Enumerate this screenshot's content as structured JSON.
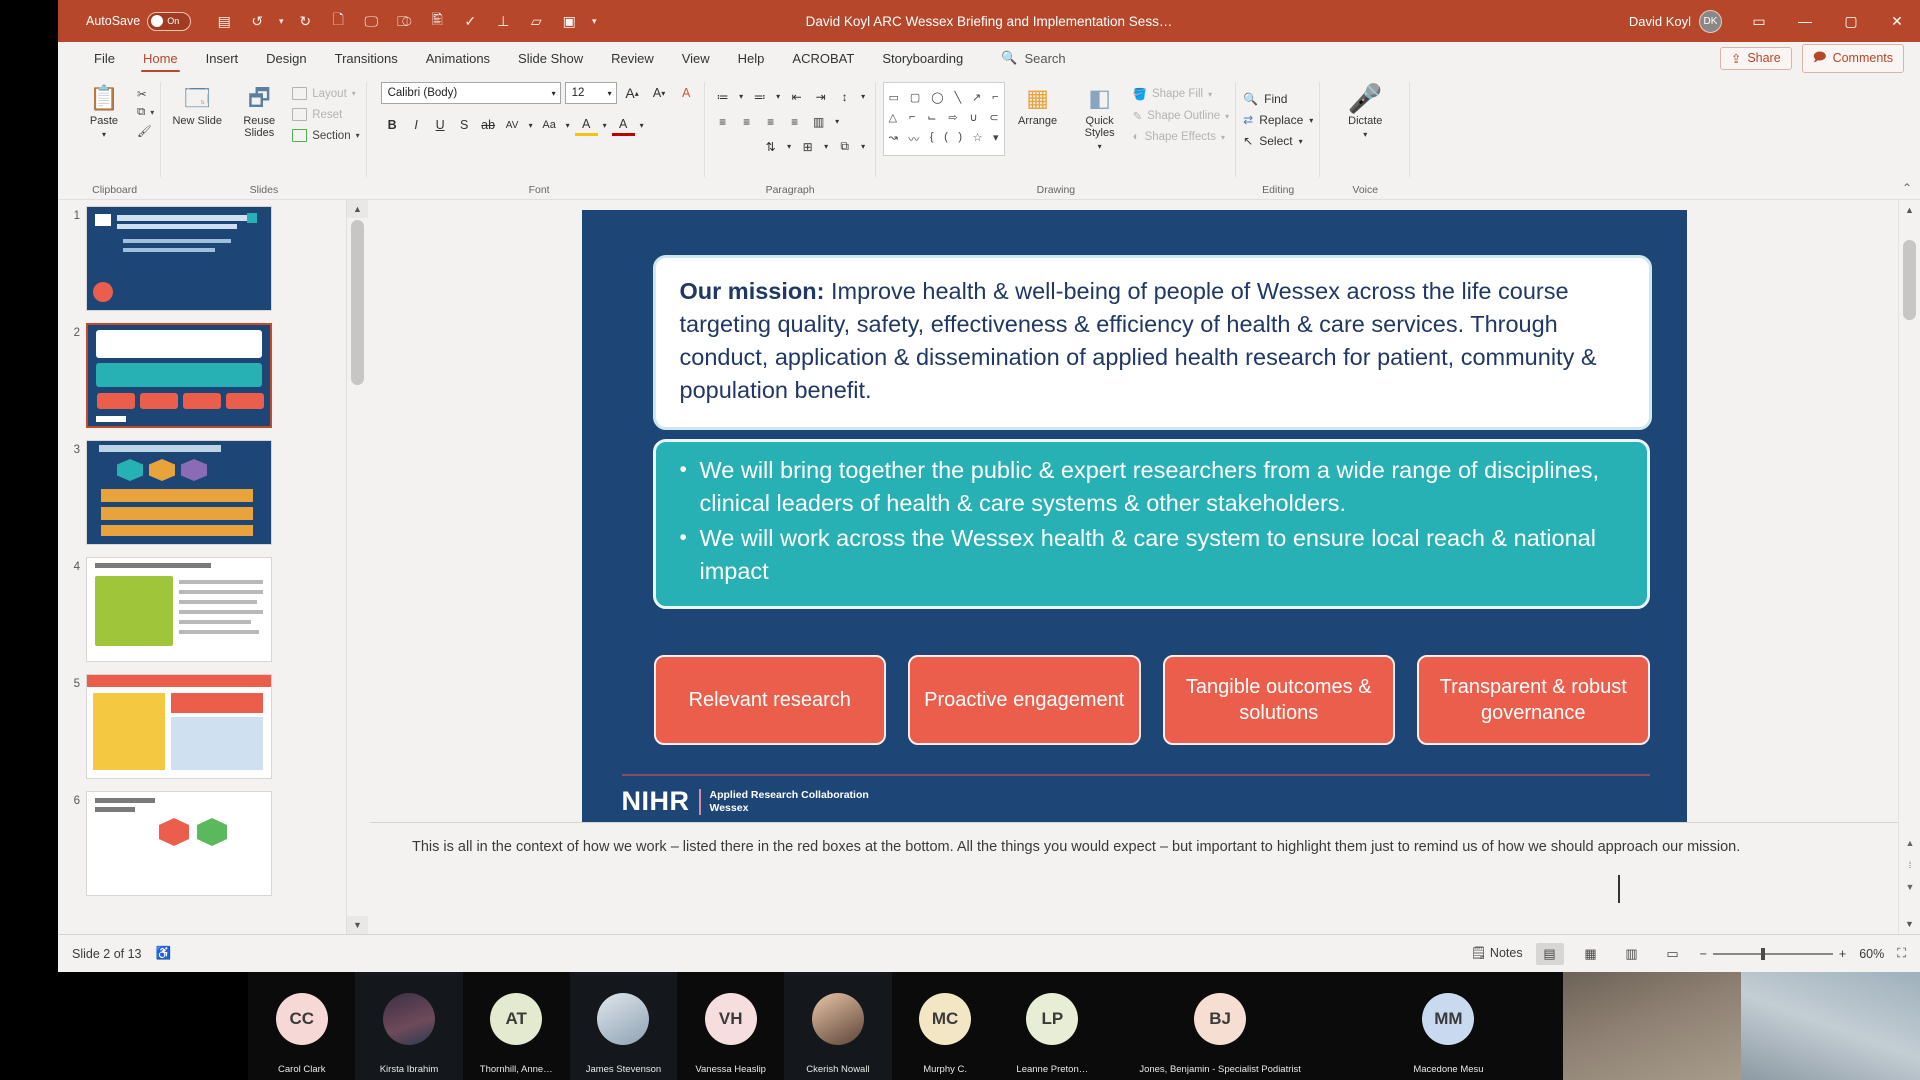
{
  "window": {
    "title": "David Koyl ARC Wessex Briefing and Implementation Sess…",
    "autosave_label": "AutoSave",
    "autosave_state": "On",
    "user_name": "David Koyl",
    "user_initials": "DK",
    "minimize": "—",
    "maximize": "▢",
    "close": "✕",
    "ribbon_display": "▭"
  },
  "quick_access": [
    {
      "name": "save-icon",
      "glyph": "▤"
    },
    {
      "name": "undo-icon",
      "glyph": "↺"
    },
    {
      "name": "undo-dropdown-icon",
      "glyph": "▾"
    },
    {
      "name": "redo-icon",
      "glyph": "↻"
    },
    {
      "name": "new-slide-icon",
      "glyph": "🗋"
    },
    {
      "name": "start-presentation-icon",
      "glyph": "🖵"
    },
    {
      "name": "present-online-icon",
      "glyph": "⎄"
    },
    {
      "name": "print-preview-icon",
      "glyph": "🖺"
    },
    {
      "name": "spelling-icon",
      "glyph": "✓"
    },
    {
      "name": "presenter-view-icon",
      "glyph": "⊥"
    },
    {
      "name": "from-beginning-icon",
      "glyph": "▱"
    },
    {
      "name": "record-icon",
      "glyph": "▣"
    },
    {
      "name": "customize-qat-icon",
      "glyph": "▾"
    }
  ],
  "tabs": [
    {
      "label": "File",
      "active": false
    },
    {
      "label": "Home",
      "active": true
    },
    {
      "label": "Insert",
      "active": false
    },
    {
      "label": "Design",
      "active": false
    },
    {
      "label": "Transitions",
      "active": false
    },
    {
      "label": "Animations",
      "active": false
    },
    {
      "label": "Slide Show",
      "active": false
    },
    {
      "label": "Review",
      "active": false
    },
    {
      "label": "View",
      "active": false
    },
    {
      "label": "Help",
      "active": false
    },
    {
      "label": "ACROBAT",
      "active": false
    },
    {
      "label": "Storyboarding",
      "active": false
    }
  ],
  "search": {
    "label": "Search",
    "icon": "search-icon"
  },
  "tab_actions": {
    "share": "Share",
    "comments": "Comments"
  },
  "ribbon": {
    "clipboard": {
      "label": "Clipboard",
      "paste": "Paste",
      "cut": "Cut",
      "copy": "Copy",
      "format_painter": "Format Painter"
    },
    "slides": {
      "label": "Slides",
      "new_slide": "New Slide",
      "reuse_slides": "Reuse Slides",
      "layout": "Layout",
      "reset": "Reset",
      "section": "Section"
    },
    "font": {
      "label": "Font",
      "family": "Calibri (Body)",
      "size": "12",
      "grow": "A",
      "shrink": "A",
      "clear_formatting": "A",
      "bold": "B",
      "italic": "I",
      "underline": "U",
      "shadow": "S",
      "strikethrough": "ab",
      "character_spacing": "AV",
      "change_case": "Aa",
      "text_highlight": "A",
      "font_color": "A"
    },
    "paragraph": {
      "label": "Paragraph",
      "bullets": "≔",
      "numbering": "≕",
      "decrease_indent": "⇤",
      "increase_indent": "⇥",
      "line_spacing": "↕",
      "align_left": "≡",
      "align_center": "≡",
      "align_right": "≡",
      "justify": "≡",
      "columns": "▥",
      "text_direction": "⇅",
      "align_text": "⊞",
      "convert_smartart": "⧉"
    },
    "drawing": {
      "label": "Drawing",
      "arrange": "Arrange",
      "quick_styles": "Quick Styles",
      "shape_fill": "Shape Fill",
      "shape_outline": "Shape Outline",
      "shape_effects": "Shape Effects"
    },
    "editing": {
      "label": "Editing",
      "find": "Find",
      "replace": "Replace",
      "select": "Select"
    },
    "voice": {
      "label": "Voice",
      "dictate": "Dictate"
    }
  },
  "thumbnails": [
    {
      "number": "1",
      "selected": false
    },
    {
      "number": "2",
      "selected": true
    },
    {
      "number": "3",
      "selected": false
    },
    {
      "number": "4",
      "selected": false
    },
    {
      "number": "5",
      "selected": false
    },
    {
      "number": "6",
      "selected": false
    }
  ],
  "slide": {
    "mission_label": "Our mission:",
    "mission_text": " Improve health & well-being of people of Wessex across the life course targeting quality, safety, effectiveness & efficiency of health & care services. Through conduct, application & dissemination of applied health research for patient, community & population benefit.",
    "aims": [
      "We will bring together the public & expert researchers from a wide range of disciplines, clinical leaders of health & care systems & other stakeholders.",
      "We will work across the Wessex health & care system to ensure local reach & national impact"
    ],
    "pills": [
      "Relevant research",
      "Proactive engagement",
      "Tangible outcomes & solutions",
      "Transparent & robust governance"
    ],
    "logo_mark": "NIHR",
    "logo_sub_line1": "Applied Research Collaboration",
    "logo_sub_line2": "Wessex",
    "colors": {
      "background": "#1d4576",
      "mission_card": "#ffffff",
      "aims_card": "#27b1b5",
      "pill": "#ea5e4b"
    }
  },
  "notes": {
    "text": "This is all in the context of how we work – listed there in the red boxes at the bottom. All the things you would expect – but important to highlight them just to remind us of how we should approach our mission."
  },
  "status_bar": {
    "slide_counter": "Slide 2 of 13",
    "accessibility_icon": "accessibility-icon",
    "notes_button": "Notes",
    "views": [
      {
        "name": "normal-view-icon",
        "glyph": "▤",
        "active": true
      },
      {
        "name": "slide-sorter-icon",
        "glyph": "▦",
        "active": false
      },
      {
        "name": "reading-view-icon",
        "glyph": "▥",
        "active": false
      },
      {
        "name": "slideshow-icon",
        "glyph": "▭",
        "active": false
      }
    ],
    "zoom_out": "−",
    "zoom_in": "+",
    "zoom_level": "60%",
    "fit_slide": "⛶"
  },
  "participants": [
    {
      "initials": "CC",
      "name": "Carol Clark",
      "color": "#f6d9d6",
      "type": "initials"
    },
    {
      "initials": "",
      "name": "Kirsta Ibrahim",
      "color": "#4a3b52",
      "type": "photo"
    },
    {
      "initials": "AT",
      "name": "Thornhill, Anne…",
      "color": "#e3ead0",
      "type": "initials"
    },
    {
      "initials": "",
      "name": "James Stevenson",
      "color": "#c8d4df",
      "type": "photo"
    },
    {
      "initials": "VH",
      "name": "Vanessa Heaslip",
      "color": "#f6dede",
      "type": "initials"
    },
    {
      "initials": "",
      "name": "Ckerish Nowall",
      "color": "#d8b49a",
      "type": "photo"
    },
    {
      "initials": "MC",
      "name": "Murphy C.",
      "color": "#f3e6c4",
      "type": "initials"
    },
    {
      "initials": "LP",
      "name": "Leanne Preton…",
      "color": "#e8edd5",
      "type": "initials"
    },
    {
      "initials": "BJ",
      "name": "Jones, Benjamin - Specialist Podiatrist",
      "color": "#f7ded2",
      "type": "initials"
    },
    {
      "initials": "MM",
      "name": "Macedone Mesu",
      "color": "#c9d9ef",
      "type": "initials"
    }
  ]
}
